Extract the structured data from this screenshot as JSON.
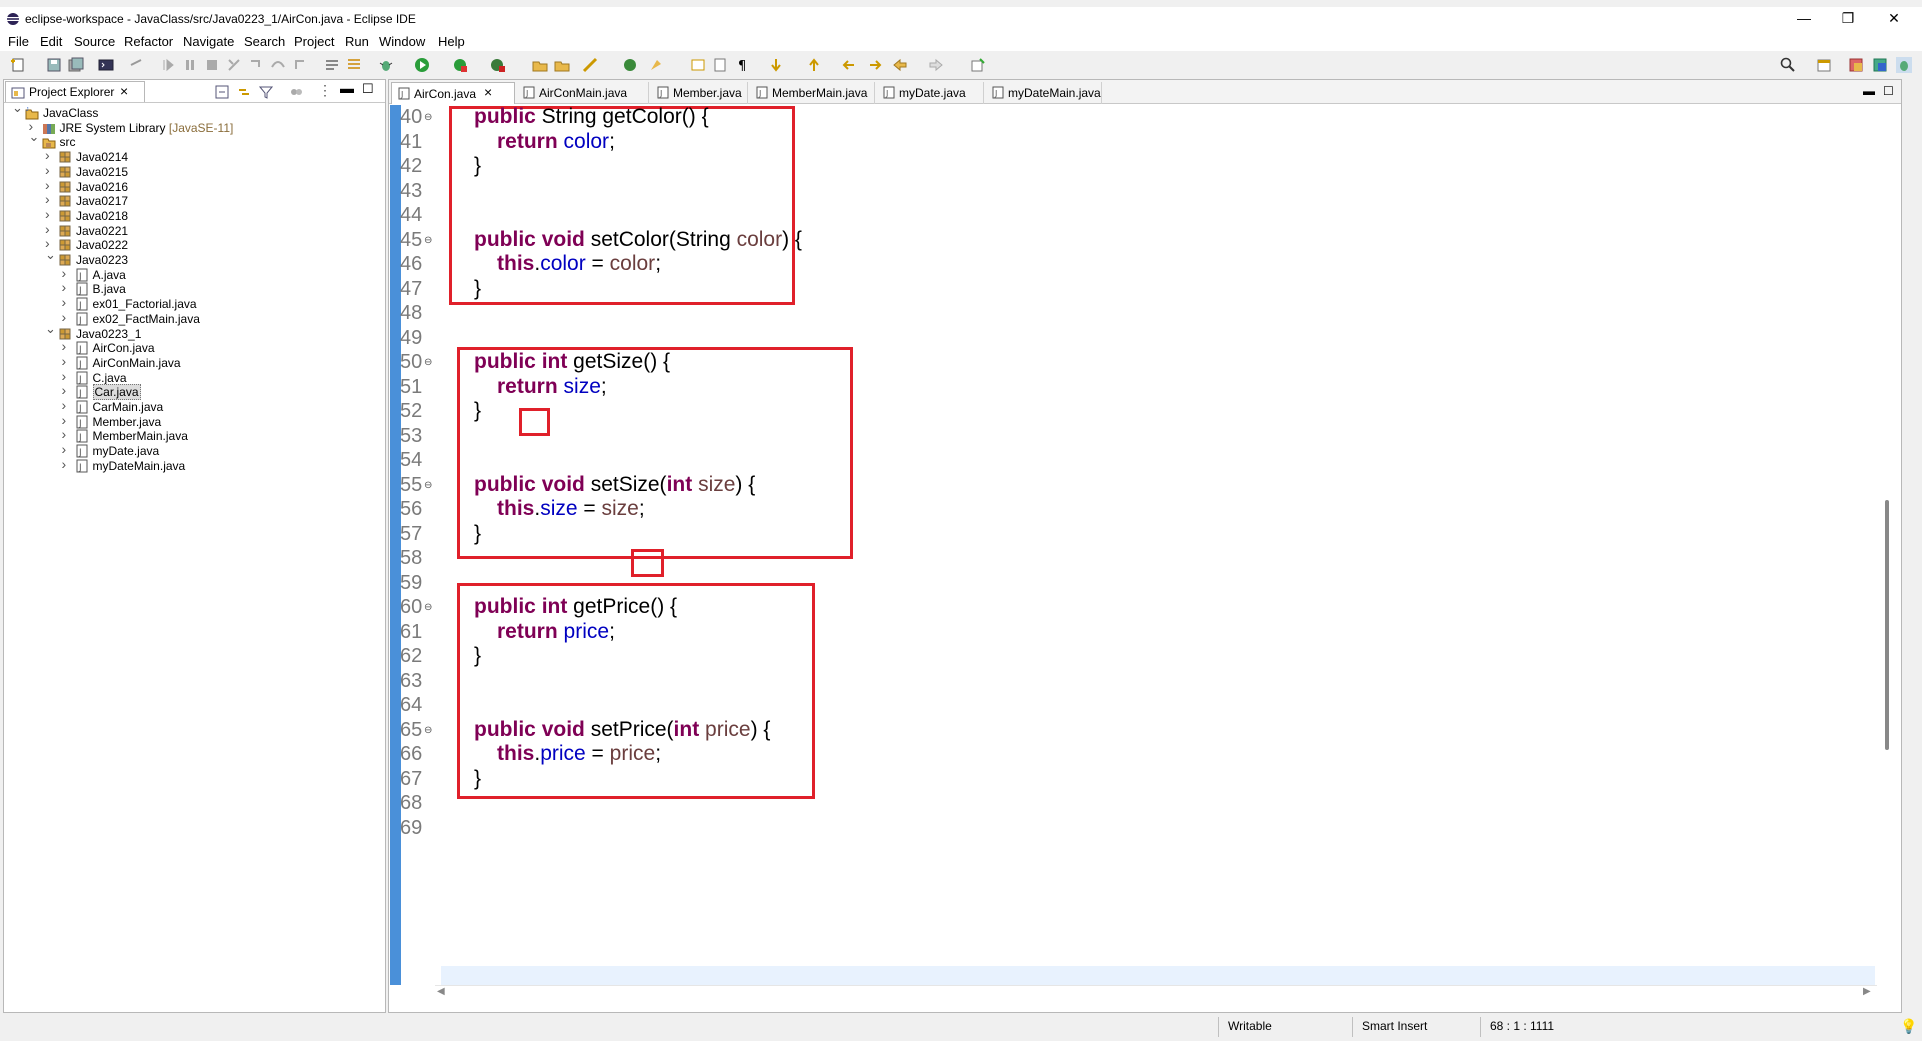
{
  "window": {
    "title": "eclipse-workspace - JavaClass/src/Java0223_1/AirCon.java - Eclipse IDE"
  },
  "window_controls": {
    "minimize": "—",
    "restore": "❐",
    "close": "✕"
  },
  "menu": [
    "File",
    "Edit",
    "Source",
    "Refactor",
    "Navigate",
    "Search",
    "Project",
    "Run",
    "Window",
    "Help"
  ],
  "explorer": {
    "tab_label": "Project Explorer",
    "tree": [
      {
        "label": "JavaClass",
        "deco": "",
        "icon": "project-icon",
        "arrow": "open"
      },
      {
        "label": "JRE System Library ",
        "deco": "[JavaSE-11]",
        "icon": "library-icon",
        "arrow": "closed"
      },
      {
        "label": "src",
        "deco": "",
        "icon": "source-folder-icon",
        "arrow": "open"
      },
      {
        "label": "Java0214",
        "deco": "",
        "icon": "package-icon",
        "arrow": "closed"
      },
      {
        "label": "Java0215",
        "deco": "",
        "icon": "package-icon",
        "arrow": "closed"
      },
      {
        "label": "Java0216",
        "deco": "",
        "icon": "package-icon",
        "arrow": "closed"
      },
      {
        "label": "Java0217",
        "deco": "",
        "icon": "package-icon",
        "arrow": "closed"
      },
      {
        "label": "Java0218",
        "deco": "",
        "icon": "package-icon",
        "arrow": "closed"
      },
      {
        "label": "Java0221",
        "deco": "",
        "icon": "package-icon",
        "arrow": "closed"
      },
      {
        "label": "Java0222",
        "deco": "",
        "icon": "package-icon",
        "arrow": "closed"
      },
      {
        "label": "Java0223",
        "deco": "",
        "icon": "package-icon",
        "arrow": "open"
      },
      {
        "label": "A.java",
        "deco": "",
        "icon": "java-file-icon",
        "arrow": "closed"
      },
      {
        "label": "B.java",
        "deco": "",
        "icon": "java-file-icon",
        "arrow": "closed"
      },
      {
        "label": "ex01_Factorial.java",
        "deco": "",
        "icon": "java-file-icon",
        "arrow": "closed"
      },
      {
        "label": "ex02_FactMain.java",
        "deco": "",
        "icon": "java-file-icon",
        "arrow": "closed"
      },
      {
        "label": "Java0223_1",
        "deco": "",
        "icon": "package-icon",
        "arrow": "open"
      },
      {
        "label": "AirCon.java",
        "deco": "",
        "icon": "java-file-icon",
        "arrow": "closed"
      },
      {
        "label": "AirConMain.java",
        "deco": "",
        "icon": "java-file-icon",
        "arrow": "closed"
      },
      {
        "label": "C.java",
        "deco": "",
        "icon": "java-file-icon",
        "arrow": "closed"
      },
      {
        "label": "Car.java",
        "deco": "",
        "icon": "java-file-icon",
        "arrow": "closed",
        "selected": true
      },
      {
        "label": "CarMain.java",
        "deco": "",
        "icon": "java-file-icon",
        "arrow": "closed"
      },
      {
        "label": "Member.java",
        "deco": "",
        "icon": "java-file-icon",
        "arrow": "closed"
      },
      {
        "label": "MemberMain.java",
        "deco": "",
        "icon": "java-file-icon",
        "arrow": "closed"
      },
      {
        "label": "myDate.java",
        "deco": "",
        "icon": "java-file-icon",
        "arrow": "closed"
      },
      {
        "label": "myDateMain.java",
        "deco": "",
        "icon": "java-file-icon",
        "arrow": "closed"
      }
    ]
  },
  "editor": {
    "tabs": [
      {
        "label": "AirCon.java",
        "active": true
      },
      {
        "label": "AirConMain.java"
      },
      {
        "label": "Member.java"
      },
      {
        "label": "MemberMain.java"
      },
      {
        "label": "myDate.java"
      },
      {
        "label": "myDateMain.java"
      }
    ],
    "lines": [
      {
        "n": "40",
        "fold": true,
        "indent": 1,
        "tokens": [
          [
            "kw",
            "public"
          ],
          [
            "t",
            " String getColor() {"
          ]
        ]
      },
      {
        "n": "41",
        "indent": 2,
        "tokens": [
          [
            "kw",
            "return"
          ],
          [
            "t",
            " "
          ],
          [
            "fld",
            "color"
          ],
          [
            "t",
            ";"
          ]
        ]
      },
      {
        "n": "42",
        "indent": 1,
        "tokens": [
          [
            "t",
            "}"
          ]
        ]
      },
      {
        "n": "43",
        "indent": 0,
        "tokens": []
      },
      {
        "n": "44",
        "indent": 0,
        "tokens": []
      },
      {
        "n": "45",
        "fold": true,
        "indent": 1,
        "tokens": [
          [
            "kw",
            "public"
          ],
          [
            "t",
            " "
          ],
          [
            "kw",
            "void"
          ],
          [
            "t",
            " setColor(String "
          ],
          [
            "prm",
            "color"
          ],
          [
            "t",
            ") {"
          ]
        ]
      },
      {
        "n": "46",
        "indent": 2,
        "tokens": [
          [
            "kw",
            "this"
          ],
          [
            "t",
            "."
          ],
          [
            "fld",
            "color"
          ],
          [
            "t",
            " = "
          ],
          [
            "prm",
            "color"
          ],
          [
            "t",
            ";"
          ]
        ]
      },
      {
        "n": "47",
        "indent": 1,
        "tokens": [
          [
            "t",
            "}"
          ]
        ]
      },
      {
        "n": "48",
        "indent": 0,
        "tokens": []
      },
      {
        "n": "49",
        "indent": 0,
        "tokens": []
      },
      {
        "n": "50",
        "fold": true,
        "indent": 1,
        "tokens": [
          [
            "kw",
            "public"
          ],
          [
            "t",
            " "
          ],
          [
            "kw",
            "int"
          ],
          [
            "t",
            " getSize() {"
          ]
        ]
      },
      {
        "n": "51",
        "indent": 2,
        "tokens": [
          [
            "kw",
            "return"
          ],
          [
            "t",
            " "
          ],
          [
            "fld",
            "size"
          ],
          [
            "t",
            ";"
          ]
        ]
      },
      {
        "n": "52",
        "indent": 1,
        "tokens": [
          [
            "t",
            "}"
          ]
        ]
      },
      {
        "n": "53",
        "indent": 0,
        "tokens": []
      },
      {
        "n": "54",
        "indent": 0,
        "tokens": []
      },
      {
        "n": "55",
        "fold": true,
        "indent": 1,
        "tokens": [
          [
            "kw",
            "public"
          ],
          [
            "t",
            " "
          ],
          [
            "kw",
            "void"
          ],
          [
            "t",
            " setSize("
          ],
          [
            "kw",
            "int"
          ],
          [
            "t",
            " "
          ],
          [
            "prm",
            "size"
          ],
          [
            "t",
            ") {"
          ]
        ]
      },
      {
        "n": "56",
        "indent": 2,
        "tokens": [
          [
            "kw",
            "this"
          ],
          [
            "t",
            "."
          ],
          [
            "fld",
            "size"
          ],
          [
            "t",
            " = "
          ],
          [
            "prm",
            "size"
          ],
          [
            "t",
            ";"
          ]
        ]
      },
      {
        "n": "57",
        "indent": 1,
        "tokens": [
          [
            "t",
            "}"
          ]
        ]
      },
      {
        "n": "58",
        "indent": 0,
        "tokens": []
      },
      {
        "n": "59",
        "indent": 0,
        "tokens": []
      },
      {
        "n": "60",
        "fold": true,
        "indent": 1,
        "tokens": [
          [
            "kw",
            "public"
          ],
          [
            "t",
            " "
          ],
          [
            "kw",
            "int"
          ],
          [
            "t",
            " getPrice() {"
          ]
        ]
      },
      {
        "n": "61",
        "indent": 2,
        "tokens": [
          [
            "kw",
            "return"
          ],
          [
            "t",
            " "
          ],
          [
            "fld",
            "price"
          ],
          [
            "t",
            ";"
          ]
        ]
      },
      {
        "n": "62",
        "indent": 1,
        "tokens": [
          [
            "t",
            "}"
          ]
        ]
      },
      {
        "n": "63",
        "indent": 0,
        "tokens": []
      },
      {
        "n": "64",
        "indent": 0,
        "tokens": []
      },
      {
        "n": "65",
        "fold": true,
        "indent": 1,
        "tokens": [
          [
            "kw",
            "public"
          ],
          [
            "t",
            " "
          ],
          [
            "kw",
            "void"
          ],
          [
            "t",
            " setPrice("
          ],
          [
            "kw",
            "int"
          ],
          [
            "t",
            " "
          ],
          [
            "prm",
            "price"
          ],
          [
            "t",
            ") {"
          ]
        ]
      },
      {
        "n": "66",
        "indent": 2,
        "tokens": [
          [
            "kw",
            "this"
          ],
          [
            "t",
            "."
          ],
          [
            "fld",
            "price"
          ],
          [
            "t",
            " = "
          ],
          [
            "prm",
            "price"
          ],
          [
            "t",
            ";"
          ]
        ]
      },
      {
        "n": "67",
        "indent": 1,
        "tokens": [
          [
            "t",
            "}"
          ]
        ]
      },
      {
        "n": "68",
        "indent": 0,
        "tokens": []
      },
      {
        "n": "69",
        "indent": 0,
        "tokens": []
      }
    ],
    "current_line": "68"
  },
  "status": {
    "writable": "Writable",
    "insert_mode": "Smart Insert",
    "position": "68 : 1 : 1111"
  },
  "colors": {
    "keyword": "#7f0055",
    "field": "#0000c0",
    "parameter": "#6a3e3e",
    "highlight_box": "#e0202a",
    "ruler": "#4a90d9"
  }
}
